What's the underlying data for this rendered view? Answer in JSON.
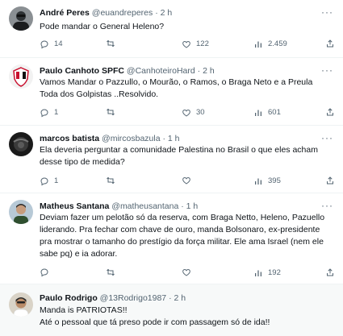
{
  "tweets": [
    {
      "name": "André Peres",
      "handle": "@euandreperes",
      "time": "2 h",
      "text": [
        "Pode mandar o General Heleno?"
      ],
      "replies": "14",
      "retweets": "",
      "likes": "122",
      "views": "2.459"
    },
    {
      "name": "Paulo Canhoto SPFC",
      "handle": "@CanhoteiroHard",
      "time": "2 h",
      "text": [
        "Vamos Mandar o Pazzullo, o Mourão, o Ramos, o Braga Neto e a Preula",
        "Toda dos Golpistas ..Resolvido."
      ],
      "replies": "1",
      "retweets": "",
      "likes": "30",
      "views": "601"
    },
    {
      "name": "marcos batista",
      "handle": "@mircosbazula",
      "time": "1 h",
      "text": [
        "Ela deveria perguntar a comunidade Palestina no Brasil o que eles acham",
        "desse tipo de medida?"
      ],
      "replies": "1",
      "retweets": "",
      "likes": "",
      "views": "395"
    },
    {
      "name": "Matheus Santana",
      "handle": "@matheusantana",
      "time": "1 h",
      "text": [
        "Deviam fazer um pelotão só da reserva, com Braga Netto, Heleno, Pazuello",
        "liderando. Pra fechar com chave de ouro, manda Bolsonaro, ex-presidente",
        "pra mostrar o tamanho do prestígio da força militar. Ele ama Israel (nem ele",
        "sabe pq) e ia adorar."
      ],
      "replies": "",
      "retweets": "",
      "likes": "",
      "views": "192"
    },
    {
      "name": "Paulo Rodrigo",
      "handle": "@13Rodrigo1987",
      "time": "2 h",
      "text": [
        "Manda is PATRIOTAS!!",
        "Até o pessoal que tá preso pode ir com passagem só de ida!!"
      ]
    }
  ],
  "colors": {
    "text": "#0f1419",
    "muted": "#536471",
    "divider": "#eff3f4",
    "highlight_bg": "#f7f9f9"
  },
  "icons": [
    "reply-icon",
    "retweet-icon",
    "like-icon",
    "views-icon",
    "share-icon",
    "more-icon"
  ]
}
